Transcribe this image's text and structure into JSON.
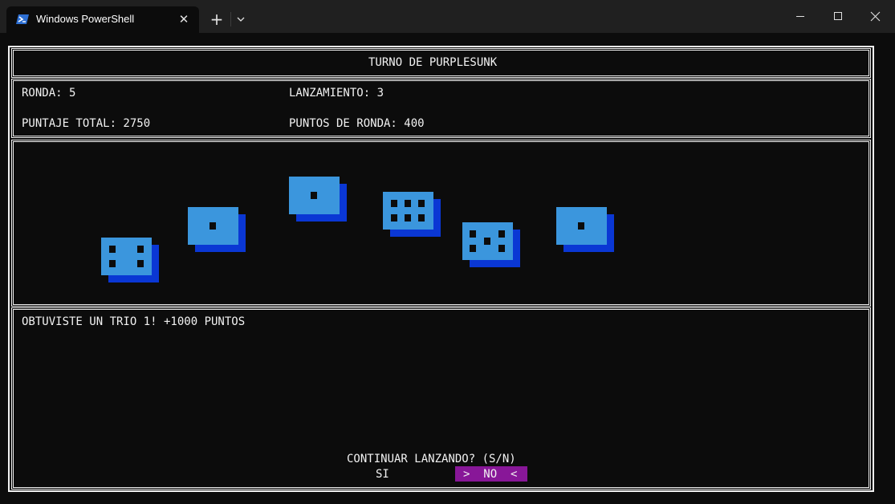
{
  "window": {
    "tab_title": "Windows PowerShell",
    "tab_icon": "powershell-icon",
    "close_tab_glyph": "✕",
    "new_tab_glyph": "+"
  },
  "game": {
    "turn_header": "TURNO DE PURPLESUNK",
    "round": "RONDA: 5",
    "throw": "LANZAMIENTO: 3",
    "total_score": "PUNTAJE TOTAL: 2750",
    "round_points": "PUNTOS DE RONDA: 400",
    "dice": [
      4,
      1,
      1,
      6,
      5,
      1
    ],
    "message": "OBTUVISTE UN TRIO 1! +1000 PUNTOS",
    "prompt": "CONTINUAR LANZANDO? (S/N)",
    "option_yes": "SI",
    "option_no": ">  NO  <",
    "selected_option": "NO"
  },
  "colors": {
    "background": "#0c0c0c",
    "die_face": "#3b96dd",
    "die_shadow": "#0a37d4",
    "selection": "#881798"
  }
}
